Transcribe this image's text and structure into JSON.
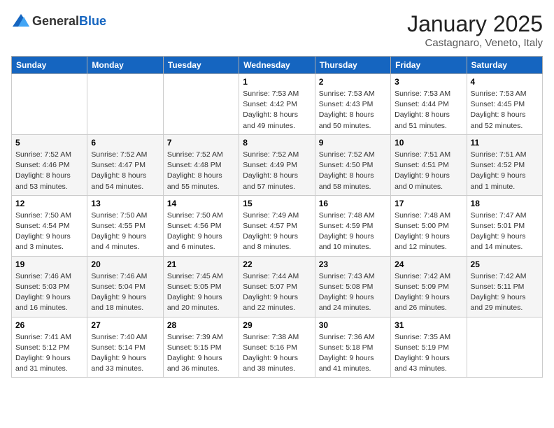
{
  "logo": {
    "general": "General",
    "blue": "Blue"
  },
  "title": "January 2025",
  "location": "Castagnaro, Veneto, Italy",
  "weekdays": [
    "Sunday",
    "Monday",
    "Tuesday",
    "Wednesday",
    "Thursday",
    "Friday",
    "Saturday"
  ],
  "weeks": [
    [
      {
        "day": "",
        "info": ""
      },
      {
        "day": "",
        "info": ""
      },
      {
        "day": "",
        "info": ""
      },
      {
        "day": "1",
        "info": "Sunrise: 7:53 AM\nSunset: 4:42 PM\nDaylight: 8 hours\nand 49 minutes."
      },
      {
        "day": "2",
        "info": "Sunrise: 7:53 AM\nSunset: 4:43 PM\nDaylight: 8 hours\nand 50 minutes."
      },
      {
        "day": "3",
        "info": "Sunrise: 7:53 AM\nSunset: 4:44 PM\nDaylight: 8 hours\nand 51 minutes."
      },
      {
        "day": "4",
        "info": "Sunrise: 7:53 AM\nSunset: 4:45 PM\nDaylight: 8 hours\nand 52 minutes."
      }
    ],
    [
      {
        "day": "5",
        "info": "Sunrise: 7:52 AM\nSunset: 4:46 PM\nDaylight: 8 hours\nand 53 minutes."
      },
      {
        "day": "6",
        "info": "Sunrise: 7:52 AM\nSunset: 4:47 PM\nDaylight: 8 hours\nand 54 minutes."
      },
      {
        "day": "7",
        "info": "Sunrise: 7:52 AM\nSunset: 4:48 PM\nDaylight: 8 hours\nand 55 minutes."
      },
      {
        "day": "8",
        "info": "Sunrise: 7:52 AM\nSunset: 4:49 PM\nDaylight: 8 hours\nand 57 minutes."
      },
      {
        "day": "9",
        "info": "Sunrise: 7:52 AM\nSunset: 4:50 PM\nDaylight: 8 hours\nand 58 minutes."
      },
      {
        "day": "10",
        "info": "Sunrise: 7:51 AM\nSunset: 4:51 PM\nDaylight: 9 hours\nand 0 minutes."
      },
      {
        "day": "11",
        "info": "Sunrise: 7:51 AM\nSunset: 4:52 PM\nDaylight: 9 hours\nand 1 minute."
      }
    ],
    [
      {
        "day": "12",
        "info": "Sunrise: 7:50 AM\nSunset: 4:54 PM\nDaylight: 9 hours\nand 3 minutes."
      },
      {
        "day": "13",
        "info": "Sunrise: 7:50 AM\nSunset: 4:55 PM\nDaylight: 9 hours\nand 4 minutes."
      },
      {
        "day": "14",
        "info": "Sunrise: 7:50 AM\nSunset: 4:56 PM\nDaylight: 9 hours\nand 6 minutes."
      },
      {
        "day": "15",
        "info": "Sunrise: 7:49 AM\nSunset: 4:57 PM\nDaylight: 9 hours\nand 8 minutes."
      },
      {
        "day": "16",
        "info": "Sunrise: 7:48 AM\nSunset: 4:59 PM\nDaylight: 9 hours\nand 10 minutes."
      },
      {
        "day": "17",
        "info": "Sunrise: 7:48 AM\nSunset: 5:00 PM\nDaylight: 9 hours\nand 12 minutes."
      },
      {
        "day": "18",
        "info": "Sunrise: 7:47 AM\nSunset: 5:01 PM\nDaylight: 9 hours\nand 14 minutes."
      }
    ],
    [
      {
        "day": "19",
        "info": "Sunrise: 7:46 AM\nSunset: 5:03 PM\nDaylight: 9 hours\nand 16 minutes."
      },
      {
        "day": "20",
        "info": "Sunrise: 7:46 AM\nSunset: 5:04 PM\nDaylight: 9 hours\nand 18 minutes."
      },
      {
        "day": "21",
        "info": "Sunrise: 7:45 AM\nSunset: 5:05 PM\nDaylight: 9 hours\nand 20 minutes."
      },
      {
        "day": "22",
        "info": "Sunrise: 7:44 AM\nSunset: 5:07 PM\nDaylight: 9 hours\nand 22 minutes."
      },
      {
        "day": "23",
        "info": "Sunrise: 7:43 AM\nSunset: 5:08 PM\nDaylight: 9 hours\nand 24 minutes."
      },
      {
        "day": "24",
        "info": "Sunrise: 7:42 AM\nSunset: 5:09 PM\nDaylight: 9 hours\nand 26 minutes."
      },
      {
        "day": "25",
        "info": "Sunrise: 7:42 AM\nSunset: 5:11 PM\nDaylight: 9 hours\nand 29 minutes."
      }
    ],
    [
      {
        "day": "26",
        "info": "Sunrise: 7:41 AM\nSunset: 5:12 PM\nDaylight: 9 hours\nand 31 minutes."
      },
      {
        "day": "27",
        "info": "Sunrise: 7:40 AM\nSunset: 5:14 PM\nDaylight: 9 hours\nand 33 minutes."
      },
      {
        "day": "28",
        "info": "Sunrise: 7:39 AM\nSunset: 5:15 PM\nDaylight: 9 hours\nand 36 minutes."
      },
      {
        "day": "29",
        "info": "Sunrise: 7:38 AM\nSunset: 5:16 PM\nDaylight: 9 hours\nand 38 minutes."
      },
      {
        "day": "30",
        "info": "Sunrise: 7:36 AM\nSunset: 5:18 PM\nDaylight: 9 hours\nand 41 minutes."
      },
      {
        "day": "31",
        "info": "Sunrise: 7:35 AM\nSunset: 5:19 PM\nDaylight: 9 hours\nand 43 minutes."
      },
      {
        "day": "",
        "info": ""
      }
    ]
  ]
}
